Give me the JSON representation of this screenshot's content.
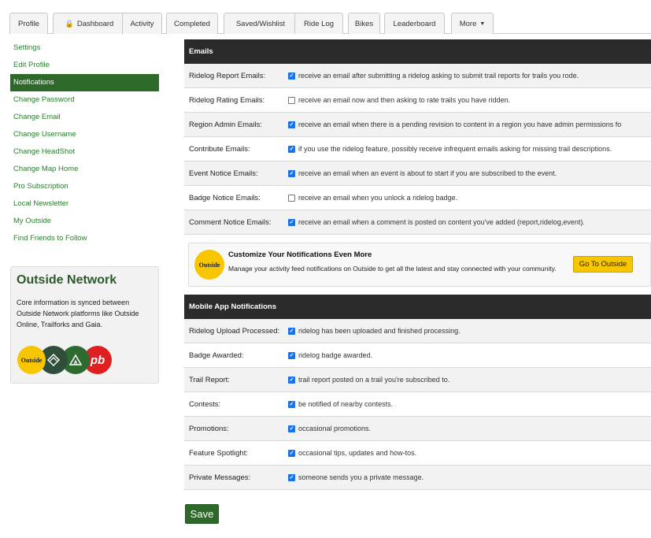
{
  "tabs": [
    {
      "label": "Profile"
    },
    {
      "label": "Dashboard"
    },
    {
      "label": "Activity"
    },
    {
      "label": "Completed"
    },
    {
      "label": "Saved/Wishlist"
    },
    {
      "label": "Ride Log"
    },
    {
      "label": "Bikes"
    },
    {
      "label": "Leaderboard"
    },
    {
      "label": "More"
    }
  ],
  "sidebar": {
    "items": [
      {
        "label": "Settings"
      },
      {
        "label": "Edit Profile"
      },
      {
        "label": "Notifications"
      },
      {
        "label": "Change Password"
      },
      {
        "label": "Change Email"
      },
      {
        "label": "Change Username"
      },
      {
        "label": "Change HeadShot"
      },
      {
        "label": "Change Map Home"
      },
      {
        "label": "Pro Subscription"
      },
      {
        "label": "Local Newsletter"
      },
      {
        "label": "My Outside"
      },
      {
        "label": "Find Friends to Follow"
      }
    ],
    "active_item": "Notifications"
  },
  "network": {
    "title": "Outside Network",
    "text": "Core information is synced between Outside Network platforms like Outside Online, Trailforks and Gaia.",
    "logos": [
      {
        "label": "Outside",
        "color": "#f7c600"
      },
      {
        "label": "",
        "color": "#2f4f3a"
      },
      {
        "label": "",
        "color": "#2e6b30"
      },
      {
        "label": "pb",
        "color": "#e02020"
      }
    ]
  },
  "emails": {
    "header": "Emails",
    "rows": [
      {
        "label": "Ridelog Report Emails:",
        "checked": true,
        "desc": "receive an email after submitting a ridelog asking to submit trail reports for trails you rode."
      },
      {
        "label": "Ridelog Rating Emails:",
        "checked": false,
        "desc": "receive an email now and then asking to rate trails you have ridden."
      },
      {
        "label": "Region Admin Emails:",
        "checked": true,
        "desc": "receive an email when there is a pending revision to content in a region you have admin permissions fo"
      },
      {
        "label": "Contribute Emails:",
        "checked": true,
        "desc": "if you use the ridelog feature, possibly receive infrequent emails asking for missing trail descriptions."
      },
      {
        "label": "Event Notice Emails:",
        "checked": true,
        "desc": "receive an email when an event is about to start if you are subscribed to the event."
      },
      {
        "label": "Badge Notice Emails:",
        "checked": false,
        "desc": "receive an email when you unlock a ridelog badge."
      },
      {
        "label": "Comment Notice Emails:",
        "checked": true,
        "desc": "receive an email when a comment is posted on content you've added (report,ridelog,event)."
      }
    ]
  },
  "promo": {
    "logo": "Outside",
    "title": "Customize Your Notifications Even More",
    "text": "Manage your activity feed notifications on Outside to get all the latest and stay connected with your community.",
    "button": "Go To Outside"
  },
  "mobile": {
    "header": "Mobile App Notifications",
    "rows": [
      {
        "label": "Ridelog Upload Processed:",
        "checked": true,
        "desc": "ridelog has been uploaded and finished processing."
      },
      {
        "label": "Badge Awarded:",
        "checked": true,
        "desc": "ridelog badge awarded."
      },
      {
        "label": "Trail Report:",
        "checked": true,
        "desc": "trail report posted on a trail you're subscribed to."
      },
      {
        "label": "Contests:",
        "checked": true,
        "desc": "be notified of nearby contests."
      },
      {
        "label": "Promotions:",
        "checked": true,
        "desc": "occasional promotions."
      },
      {
        "label": "Feature Spotlight:",
        "checked": true,
        "desc": "occasional tips, updates and how-tos."
      },
      {
        "label": "Private Messages:",
        "checked": true,
        "desc": "someone sends you a private message."
      }
    ]
  },
  "save_label": "Save",
  "colors": {
    "accent_green": "#2d6a2a",
    "link_green": "#2a7d2e",
    "header_dark": "#2b2b2b",
    "checkbox_blue": "#1a73e8",
    "outside_yellow": "#f7c600"
  }
}
